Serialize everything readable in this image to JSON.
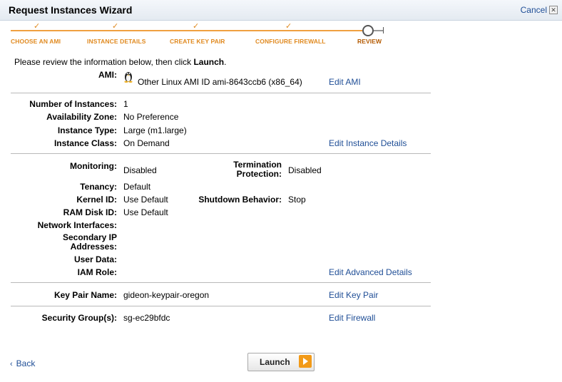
{
  "header": {
    "title": "Request Instances Wizard",
    "cancel_label": "Cancel",
    "close_icon": "☒"
  },
  "steps": [
    {
      "label": "CHOOSE AN AMI",
      "done": true
    },
    {
      "label": "INSTANCE DETAILS",
      "done": true
    },
    {
      "label": "CREATE KEY PAIR",
      "done": true
    },
    {
      "label": "CONFIGURE FIREWALL",
      "done": true
    },
    {
      "label": "REVIEW",
      "done": false,
      "current": true
    }
  ],
  "check_glyph": "✓",
  "intro": {
    "prefix": "Please review the information below, then click ",
    "emphasis": "Launch",
    "suffix": "."
  },
  "ami": {
    "label": "AMI:",
    "value": "Other Linux AMI ID ami-8643ccb6 (x86_64)",
    "edit": "Edit AMI",
    "icon": "linux-penguin-icon"
  },
  "instance": {
    "num_label": "Number of Instances:",
    "num_value": "1",
    "az_label": "Availability Zone:",
    "az_value": "No Preference",
    "type_label": "Instance Type:",
    "type_value": "Large (m1.large)",
    "class_label": "Instance Class:",
    "class_value": "On Demand",
    "edit": "Edit Instance Details"
  },
  "advanced": {
    "monitoring_label": "Monitoring:",
    "monitoring_value": "Disabled",
    "termination_label_1": "Termination",
    "termination_label_2": "Protection:",
    "termination_value": "Disabled",
    "tenancy_label": "Tenancy:",
    "tenancy_value": "Default",
    "kernel_label": "Kernel ID:",
    "kernel_value": "Use Default",
    "shutdown_label": "Shutdown Behavior:",
    "shutdown_value": "Stop",
    "ramdisk_label": "RAM Disk ID:",
    "ramdisk_value": "Use Default",
    "network_label": "Network Interfaces:",
    "secondary_label_1": "Secondary IP",
    "secondary_label_2": "Addresses:",
    "userdata_label": "User Data:",
    "iam_label": "IAM Role:",
    "edit": "Edit Advanced Details"
  },
  "keypair": {
    "label": "Key Pair Name:",
    "value": "gideon-keypair-oregon",
    "edit": "Edit Key Pair"
  },
  "security": {
    "label": "Security Group(s):",
    "value": "sg-ec29bfdc",
    "edit": "Edit Firewall"
  },
  "footer": {
    "back_label": "Back",
    "back_chevron": "‹",
    "launch_label": "Launch"
  },
  "colors": {
    "link": "#1f4e96",
    "step_accent": "#e08a20",
    "launch_arrow": "#f29a18"
  }
}
